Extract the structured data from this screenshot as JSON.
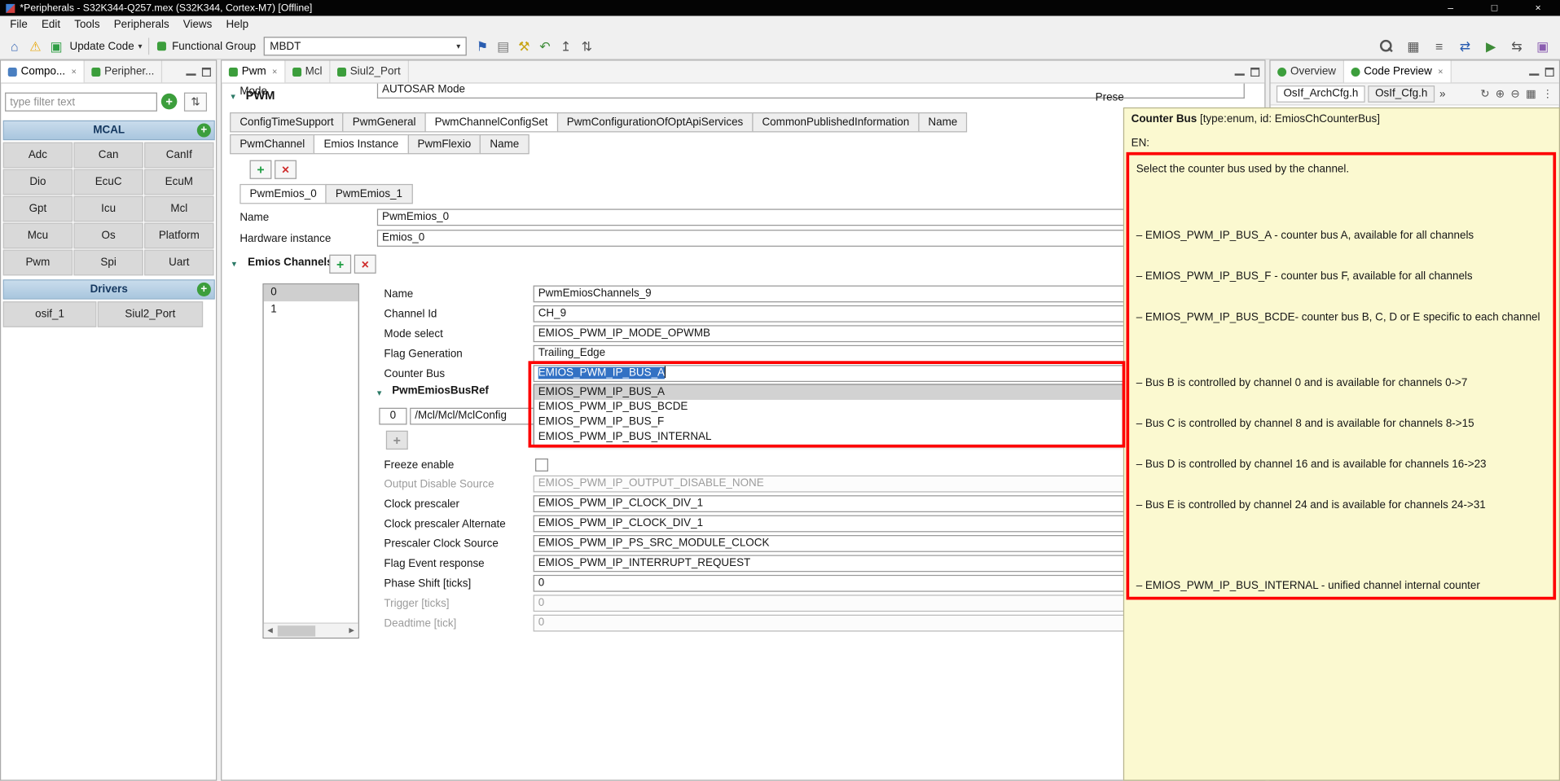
{
  "colors": {
    "annotation_red": "#fe0000",
    "tooltip_bg": "#fbf9d0",
    "selection_blue": "#3271c4",
    "header_blue": "#b7cfe3"
  },
  "icons": {
    "minimize": "–",
    "maximize": "□",
    "close": "×",
    "home": "⌂",
    "warning": "⚠",
    "update_code": "▣",
    "caret": "▾",
    "flag": "⚑",
    "report": "▤",
    "tools": "⚒",
    "undo": "↶",
    "export": "↥",
    "sort": "⇅",
    "grid": "▦",
    "list": "≡",
    "swap": "⇄",
    "run": "▶",
    "sync": "⇆",
    "palette": "▣",
    "chevron_down": "▾",
    "scroll_left": "◀",
    "scroll_right": "▶",
    "plus": "+",
    "cross": "×",
    "refresh": "↻",
    "zoom_in": "⊕",
    "zoom_out": "⊖",
    "columns": "▦",
    "more": "⋮",
    "overflow": "»"
  },
  "window": {
    "title": "*Peripherals - S32K344-Q257.mex (S32K344, Cortex-M7) [Offline]"
  },
  "menubar": [
    "File",
    "Edit",
    "Tools",
    "Peripherals",
    "Views",
    "Help"
  ],
  "toolbar": {
    "update_code": "Update Code",
    "functional_group": "Functional Group",
    "functional_group_value": "MBDT"
  },
  "left_panel": {
    "tabs": [
      "Compo...",
      "Peripher..."
    ],
    "filter_placeholder": "type filter text",
    "mcal_title": "MCAL",
    "mcal_items": [
      "Adc",
      "Can",
      "CanIf",
      "Dio",
      "EcuC",
      "EcuM",
      "Gpt",
      "Icu",
      "Mcl",
      "Mcu",
      "Os",
      "Platform",
      "Pwm",
      "Spi",
      "Uart"
    ],
    "drivers_title": "Drivers",
    "drivers_items": [
      "osif_1",
      "Siul2_Port"
    ]
  },
  "editor": {
    "tabs": [
      "Pwm",
      "Mcl",
      "Siul2_Port"
    ],
    "mode_label": "Mode",
    "mode_value": "AUTOSAR Mode",
    "section_title": "PWM",
    "presets_label": "Prese",
    "config_tabs": [
      "ConfigTimeSupport",
      "PwmGeneral",
      "PwmChannelConfigSet",
      "PwmConfigurationOfOptApiServices",
      "CommonPublishedInformation",
      "Name"
    ],
    "sub_tabs": [
      "PwmChannel",
      "Emios Instance",
      "PwmFlexio",
      "Name"
    ],
    "instance_tabs": [
      "PwmEmios_0",
      "PwmEmios_1"
    ],
    "name_label": "Name",
    "name_value": "PwmEmios_0",
    "hw_label": "Hardware instance",
    "hw_value": "Emios_0",
    "channels_title": "Emios Channels",
    "channel_rows": [
      "0",
      "1"
    ],
    "channel": {
      "name": {
        "label": "Name",
        "value": "PwmEmiosChannels_9"
      },
      "channel_id": {
        "label": "Channel Id",
        "value": "CH_9"
      },
      "mode": {
        "label": "Mode select",
        "value": "EMIOS_PWM_IP_MODE_OPWMB"
      },
      "flag_gen": {
        "label": "Flag Generation",
        "value": "Trailing_Edge"
      },
      "counter_bus": {
        "label": "Counter Bus",
        "value": "EMIOS_PWM_IP_BUS_A",
        "options": [
          "EMIOS_PWM_IP_BUS_A",
          "EMIOS_PWM_IP_BUS_BCDE",
          "EMIOS_PWM_IP_BUS_F",
          "EMIOS_PWM_IP_BUS_INTERNAL"
        ]
      },
      "busref": {
        "title": "PwmEmiosBusRef",
        "index": "0",
        "value": "/Mcl/Mcl/MclConfig"
      },
      "freeze": {
        "label": "Freeze enable"
      },
      "output_disable": {
        "label": "Output Disable Source",
        "value": "EMIOS_PWM_IP_OUTPUT_DISABLE_NONE"
      },
      "clock_prescaler": {
        "label": "Clock prescaler",
        "value": "EMIOS_PWM_IP_CLOCK_DIV_1"
      },
      "clock_prescaler_alt": {
        "label": "Clock prescaler Alternate",
        "value": "EMIOS_PWM_IP_CLOCK_DIV_1"
      },
      "prescaler_clock_source": {
        "label": "Prescaler Clock Source",
        "value": "EMIOS_PWM_IP_PS_SRC_MODULE_CLOCK"
      },
      "flag_event": {
        "label": "Flag Event response",
        "value": "EMIOS_PWM_IP_INTERRUPT_REQUEST"
      },
      "phase_shift": {
        "label": "Phase Shift [ticks]",
        "value": "0"
      },
      "trigger": {
        "label": "Trigger [ticks]",
        "value": "0"
      },
      "deadtime": {
        "label": "Deadtime [tick]",
        "value": "0"
      }
    }
  },
  "right_panel": {
    "tabs": [
      "Overview",
      "Code Preview"
    ],
    "file_tabs": [
      "OsIf_ArchCfg.h",
      "OsIf_Cfg.h"
    ]
  },
  "tooltip": {
    "title_bold": "Counter Bus",
    "title_rest": " [type:enum, id: EmiosChCounterBus]",
    "lang": "EN:",
    "description": "Select the counter bus used by the channel.",
    "items": [
      "– EMIOS_PWM_IP_BUS_A - counter bus A, available for all channels",
      "– EMIOS_PWM_IP_BUS_F - counter bus F, available for all channels",
      "– EMIOS_PWM_IP_BUS_BCDE- counter bus B, C, D or E specific to each channel",
      "– Bus B is controlled by channel 0 and is available for channels 0->7",
      "– Bus C is controlled by channel 8 and is available for channels 8->15",
      "– Bus D is controlled by channel 16 and is available for channels 16->23",
      "– Bus E is controlled by channel 24 and is available for channels 24->31",
      "– EMIOS_PWM_IP_BUS_INTERNAL - unified channel internal counter"
    ]
  }
}
